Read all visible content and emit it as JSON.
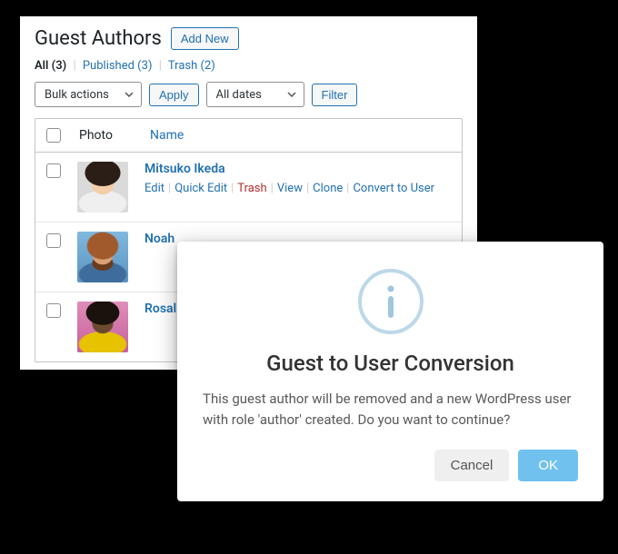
{
  "header": {
    "title": "Guest Authors",
    "add_new": "Add New"
  },
  "status_filters": {
    "all": {
      "label": "All",
      "count": 3
    },
    "published": {
      "label": "Published",
      "count": 3
    },
    "trash": {
      "label": "Trash",
      "count": 2
    }
  },
  "filters": {
    "bulk_label": "Bulk actions",
    "apply": "Apply",
    "dates_label": "All dates",
    "filter": "Filter"
  },
  "table": {
    "columns": {
      "photo": "Photo",
      "name": "Name"
    },
    "actions": {
      "edit": "Edit",
      "quick_edit": "Quick Edit",
      "trash": "Trash",
      "view": "View",
      "clone": "Clone",
      "convert": "Convert to User"
    },
    "rows": [
      {
        "name": "Mitsuko Ikeda"
      },
      {
        "name": "Noah "
      },
      {
        "name": "Rosali"
      }
    ]
  },
  "modal": {
    "title": "Guest to User Conversion",
    "message": "This guest author will be removed and a new WordPress user with role 'author' created. Do you want to continue?",
    "cancel": "Cancel",
    "ok": "OK"
  }
}
